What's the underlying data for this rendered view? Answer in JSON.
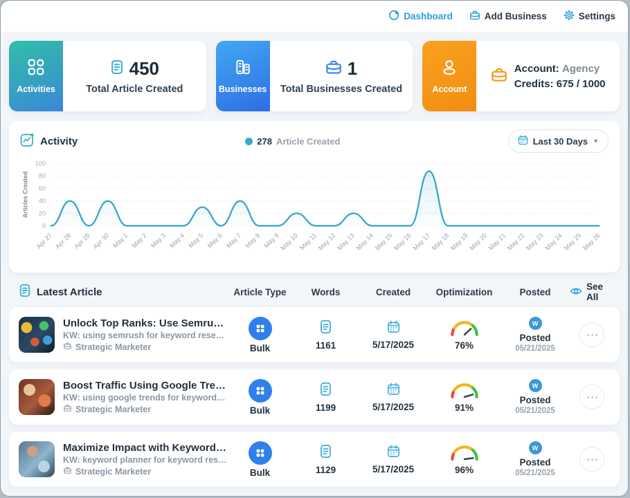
{
  "topbar": {
    "items": [
      {
        "icon": "pie-chart-icon",
        "label": "Dashboard"
      },
      {
        "icon": "briefcase-icon",
        "label": "Add Business"
      },
      {
        "icon": "gear-icon",
        "label": "Settings"
      }
    ]
  },
  "colors": {
    "accent_blue": "#2d9cdb",
    "chart_line": "#3aa7cb",
    "bulk_blue": "#2f80ed",
    "account_orange": "#f8991d",
    "gauge_red": "#e74c3c",
    "gauge_yellow": "#f4b41a",
    "gauge_green": "#44c13c"
  },
  "stats": [
    {
      "tab_label": "Activities",
      "value": "450",
      "label": "Total Article Created"
    },
    {
      "tab_label": "Businesses",
      "value": "1",
      "label": "Total Businesses Created"
    },
    {
      "tab_label": "Account",
      "account_key": "Account:",
      "account_value": "Agency",
      "credits_key": "Credits:",
      "credits_value": "675 / 1000"
    }
  ],
  "activity": {
    "title": "Activity",
    "legend_value": "278",
    "legend_label": "Article Created",
    "range_label": "Last 30 Days"
  },
  "chart_data": {
    "type": "line",
    "title": "Activity",
    "xlabel": "",
    "ylabel": "Articles Created",
    "ylim": [
      0,
      100
    ],
    "yticks": [
      0,
      20,
      40,
      60,
      80,
      100
    ],
    "grid": true,
    "legend": [
      {
        "label": "Article Created",
        "total": 278,
        "color": "#3aa7cb"
      }
    ],
    "x": [
      "Apr 27",
      "Apr 28",
      "Apr 29",
      "Apr 30",
      "May 1",
      "May 2",
      "May 3",
      "May 4",
      "May 5",
      "May 6",
      "May 7",
      "May 8",
      "May 9",
      "May 10",
      "May 11",
      "May 12",
      "May 13",
      "May 14",
      "May 15",
      "May 16",
      "May 17",
      "May 18",
      "May 19",
      "May 20",
      "May 21",
      "May 22",
      "May 23",
      "May 24",
      "May 25",
      "May 26"
    ],
    "values": [
      0,
      40,
      0,
      40,
      0,
      0,
      0,
      0,
      30,
      0,
      40,
      0,
      0,
      20,
      0,
      0,
      20,
      0,
      0,
      0,
      88,
      0,
      0,
      0,
      0,
      0,
      0,
      0,
      0,
      0
    ]
  },
  "table": {
    "title": "Latest Article",
    "columns": [
      "Article Type",
      "Words",
      "Created",
      "Optimization",
      "Posted"
    ],
    "see_all": "See All",
    "rows": [
      {
        "title": "Unlock Top Ranks: Use Semrush for Key...",
        "kw": "KW: using semrush for keyword research",
        "author": "Strategic Marketer",
        "type": "Bulk",
        "words": "1161",
        "created": "5/17/2025",
        "optimization": "76%",
        "opt_percent": 76,
        "posted_status": "Posted",
        "posted_date": "05/21/2025"
      },
      {
        "title": "Boost Traffic Using Google Trends for Ke...",
        "kw": "KW: using google trends for keyword research",
        "author": "Strategic Marketer",
        "type": "Bulk",
        "words": "1199",
        "created": "5/17/2025",
        "optimization": "91%",
        "opt_percent": 91,
        "posted_status": "Posted",
        "posted_date": "05/21/2025"
      },
      {
        "title": "Maximize Impact with Keyword Planner ...",
        "kw": "KW: keyword planner for keyword research",
        "author": "Strategic Marketer",
        "type": "Bulk",
        "words": "1129",
        "created": "5/17/2025",
        "optimization": "96%",
        "opt_percent": 96,
        "posted_status": "Posted",
        "posted_date": "05/21/2025"
      }
    ]
  }
}
